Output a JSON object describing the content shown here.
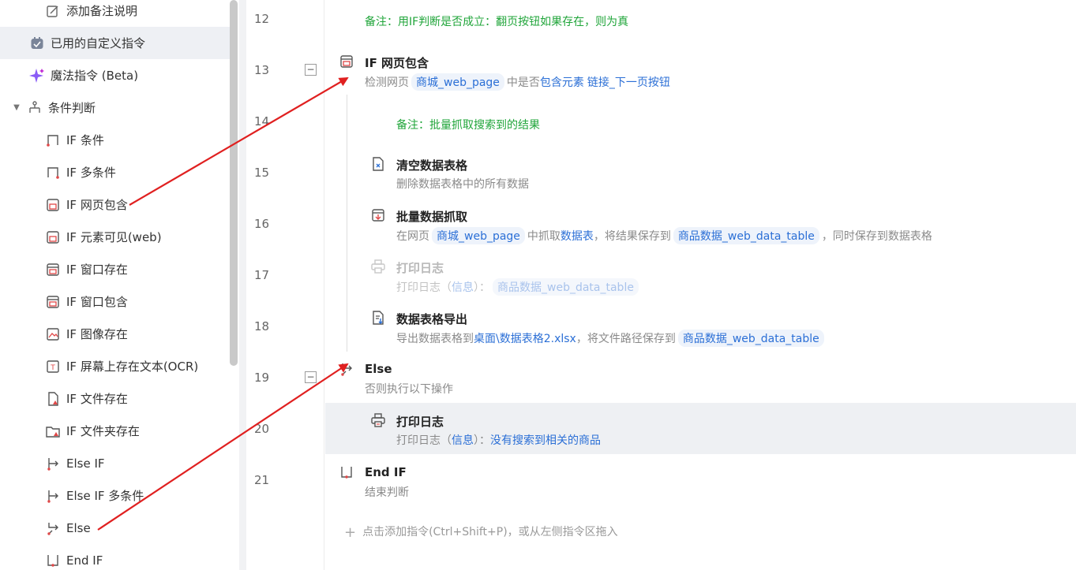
{
  "sidebar": {
    "items": [
      {
        "label": "添加备注说明",
        "icon": "edit-note-icon"
      },
      {
        "label": "已用的自定义指令",
        "icon": "custom-command-icon"
      },
      {
        "label": "魔法指令 (Beta)",
        "icon": "sparkle-icon"
      },
      {
        "label": "条件判断",
        "icon": "branch-icon"
      },
      {
        "label": "IF 条件",
        "icon": "if-icon"
      },
      {
        "label": "IF 多条件",
        "icon": "if-icon"
      },
      {
        "label": "IF 网页包含",
        "icon": "web-if-icon"
      },
      {
        "label": "IF 元素可见(web)",
        "icon": "web-if-icon"
      },
      {
        "label": "IF 窗口存在",
        "icon": "window-if-icon"
      },
      {
        "label": "IF 窗口包含",
        "icon": "window-if-icon"
      },
      {
        "label": "IF 图像存在",
        "icon": "image-if-icon"
      },
      {
        "label": "IF 屏幕上存在文本(OCR)",
        "icon": "ocr-if-icon"
      },
      {
        "label": "IF 文件存在",
        "icon": "file-if-icon"
      },
      {
        "label": "IF 文件夹存在",
        "icon": "folder-if-icon"
      },
      {
        "label": "Else IF",
        "icon": "else-if-icon"
      },
      {
        "label": "Else IF 多条件",
        "icon": "else-if-icon"
      },
      {
        "label": "Else",
        "icon": "else-icon"
      },
      {
        "label": "End IF",
        "icon": "end-if-icon"
      }
    ]
  },
  "lines": [
    "12",
    "13",
    "14",
    "15",
    "16",
    "17",
    "18",
    "19",
    "20",
    "21"
  ],
  "steps": {
    "note12": "备注：用IF判断是否成立：翻页按钮如果存在，则为真",
    "s13": {
      "title": "IF 网页包含",
      "d1": "检测网页",
      "chip1": "商城_web_page",
      "d2": "中是否",
      "k1": "包含元素",
      "k2": "链接_下一页按钮"
    },
    "note14": "备注：批量抓取搜索到的结果",
    "s15": {
      "title": "清空数据表格",
      "desc": "删除数据表格中的所有数据"
    },
    "s16": {
      "title": "批量数据抓取",
      "d1": "在网页",
      "chip1": "商城_web_page",
      "d2": "中抓取",
      "k1": "数据表",
      "d3": "，将结果保存到",
      "chip2": "商品数据_web_data_table",
      "d4": "，同时保存到数据表格"
    },
    "s17": {
      "title": "打印日志",
      "d1": "打印日志（",
      "k1": "信息",
      "d2": "）：",
      "chip1": "商品数据_web_data_table"
    },
    "s18": {
      "title": "数据表格导出",
      "d1": "导出数据表格到",
      "k1": "桌面\\数据表格2.xlsx",
      "d2": "，将文件路径保存到",
      "chip1": "商品数据_web_data_table"
    },
    "s19": {
      "title": "Else",
      "desc": "否则执行以下操作"
    },
    "s20": {
      "title": "打印日志",
      "d1": "打印日志（",
      "k1": "信息",
      "d2": "）：",
      "k2": "没有搜索到相关的商品"
    },
    "s21": {
      "title": "End IF",
      "desc": "结束判断"
    }
  },
  "add_hint": "点击添加指令(Ctrl+Shift+P)，或从左侧指令区拖入",
  "colors": {
    "accent": "#2b6fd6",
    "note": "#20a53a",
    "arrow": "#e02020",
    "selected_row": "#eef0f3"
  }
}
